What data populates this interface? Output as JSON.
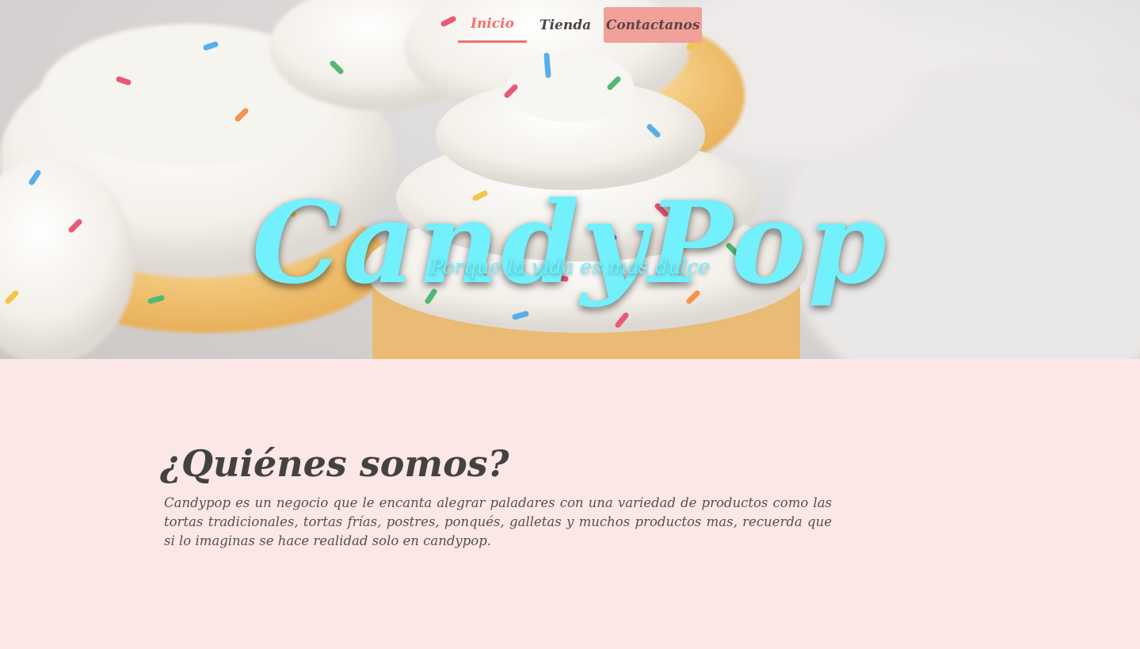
{
  "nav": {
    "items": [
      {
        "label": "Inicio",
        "active": true
      },
      {
        "label": "Tienda",
        "active": false
      },
      {
        "label": "Contactanos",
        "active": false
      }
    ]
  },
  "hero": {
    "brand": "CandyPop",
    "tagline": "Porque la vida es mas dulce",
    "background": "cupcakes-photo"
  },
  "about": {
    "title": "¿Quiénes somos?",
    "body": "Candypop es un negocio que le encanta alegrar paladares con una variedad de productos como las tortas tradicionales, tortas frías, postres, ponqués, galletas y muchos productos mas, recuerda que si lo imaginas se hace realidad solo en candypop."
  },
  "colors": {
    "accent": "#f2706a",
    "cta_bg": "#f2a09a",
    "brand": "#72f0fb",
    "section_bg": "#fbe7e6",
    "text_dark": "#444141"
  }
}
